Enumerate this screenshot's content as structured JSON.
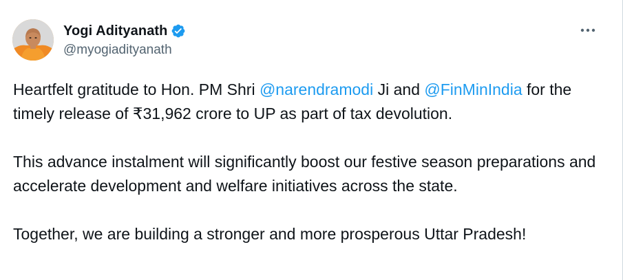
{
  "author": {
    "display_name": "Yogi Adityanath",
    "handle": "@myogiadityanath",
    "verified": true,
    "avatar_icon": "profile-photo",
    "verified_icon": "verified-badge-icon"
  },
  "menu": {
    "icon": "more-options-icon"
  },
  "tweet": {
    "p1": {
      "t1": "Heartfelt gratitude to Hon. PM Shri ",
      "m1": "@narendramodi",
      "t2": " Ji and ",
      "m2": "@FinMinIndia",
      "t3": " for the timely release of ₹31,962 crore to UP as part of tax devolution."
    },
    "p2": "This advance instalment will significantly boost our festive season preparations and accelerate development and welfare initiatives across the state.",
    "p3": "Together, we are building a stronger and more prosperous Uttar Pradesh!"
  },
  "colors": {
    "text": "#0f1419",
    "secondary": "#536471",
    "link": "#1d9bf0",
    "verified": "#1d9bf0"
  }
}
